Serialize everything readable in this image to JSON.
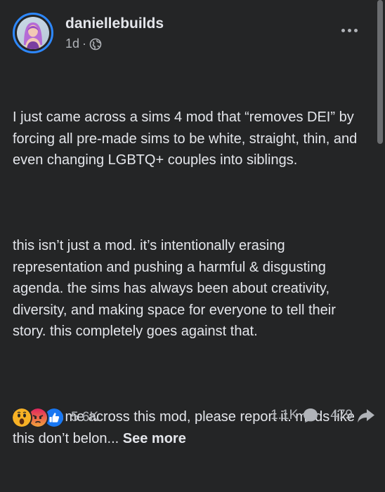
{
  "post": {
    "author": "daniellebuilds",
    "timestamp": "1d",
    "separator": "·",
    "audience_icon": "globe-icon",
    "more_icon": "more-options-icon",
    "paragraphs": [
      "I just came across a sims 4 mod that “removes DEI” by forcing all pre-made sims to be white, straight, thin, and even changing LGBTQ+ couples into siblings.",
      "this isn’t just a mod. it’s intentionally erasing representation and pushing a harmful & disgusting agenda. the sims has always been about creativity, diversity, and making space for everyone to tell their story. this completely goes against that.",
      "if you come across this mod, please report it. mods like this don’t belon..."
    ],
    "see_more": "See more"
  },
  "footer": {
    "reactions": [
      "wow",
      "angry",
      "like"
    ],
    "reaction_count": "5.6K",
    "comment_count": "1.1K",
    "comment_icon": "comment-icon",
    "share_count": "479",
    "share_icon": "share-icon"
  },
  "colors": {
    "background": "#242526",
    "text": "#e4e6eb",
    "secondary": "#b0b3b8",
    "avatar_ring": "#2d88ff",
    "like": "#1877f2",
    "angry": "#e9710f",
    "wow": "#f7b125"
  }
}
